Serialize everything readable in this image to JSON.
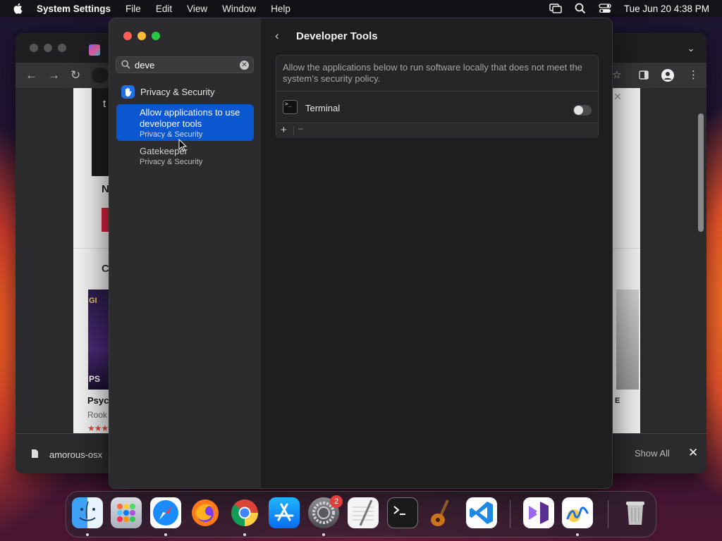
{
  "menubar": {
    "app_name": "System Settings",
    "menus": [
      "File",
      "Edit",
      "View",
      "Window",
      "Help"
    ],
    "clock": "Tue Jun 20  4:38 PM"
  },
  "browser": {
    "page_fragments": {
      "dark_heading": "t",
      "heading_n": "N",
      "heading_c": "C",
      "book_title_top": "GI",
      "book_title_bottom": "PS",
      "book_name": "Psyc",
      "book_author": "Rook",
      "stars": "★★★",
      "right_book_label": "E"
    },
    "download_name": "amorous-osx",
    "show_all": "Show All"
  },
  "settings": {
    "search": {
      "value": "deve",
      "placeholder": "Search"
    },
    "category": "Privacy & Security",
    "results": [
      {
        "main": "Allow applications to use developer tools",
        "sub": "Privacy & Security",
        "selected": true
      },
      {
        "main": "Gatekeeper",
        "sub": "Privacy & Security",
        "selected": false
      }
    ],
    "content": {
      "title": "Developer Tools",
      "description": "Allow the applications below to run software locally that does not meet the system’s security policy.",
      "apps": [
        {
          "name": "Terminal",
          "enabled": false
        }
      ],
      "add_label": "+",
      "remove_label": "−"
    }
  },
  "dock": {
    "apps": [
      "Finder",
      "Launchpad",
      "Safari",
      "Firefox",
      "Chrome",
      "App Store",
      "System Settings",
      "TextEdit",
      "Terminal",
      "Instruments",
      "Visual Studio Code",
      "Visual Studio",
      "Freeform",
      "Trash"
    ],
    "settings_badge": "2"
  },
  "colors": {
    "accent": "#0a57d0",
    "toggle_off": "#4a4a4c",
    "badge": "#e43b3b"
  }
}
